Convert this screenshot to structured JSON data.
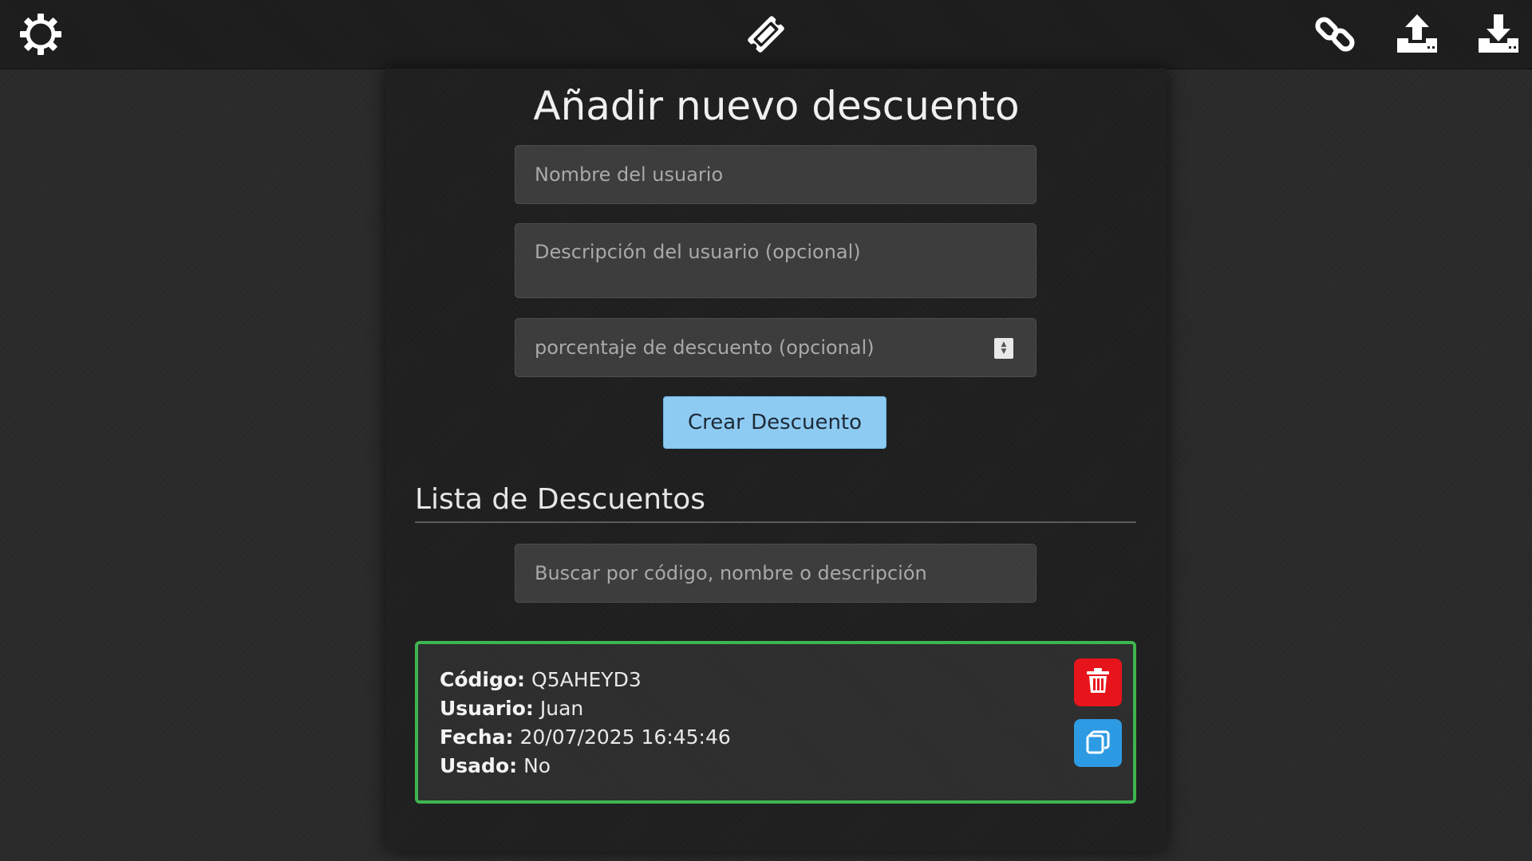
{
  "topbar": {
    "settings_icon": "gear-icon",
    "logo_icon": "ticket-icon",
    "link_icon": "link-icon",
    "upload_icon": "upload-icon",
    "download_icon": "download-icon"
  },
  "form": {
    "title": "Añadir nuevo descuento",
    "name_placeholder": "Nombre del usuario",
    "description_placeholder": "Descripción del usuario (opcional)",
    "percent_placeholder": "porcentaje de descuento (opcional)",
    "submit_label": "Crear Descuento"
  },
  "list": {
    "title": "Lista de Descuentos",
    "search_placeholder": "Buscar por código, nombre o descripción",
    "items": [
      {
        "code_label": "Código:",
        "code": "Q5AHEYD3",
        "user_label": "Usuario:",
        "user": "Juan",
        "date_label": "Fecha:",
        "date": "20/07/2025 16:45:46",
        "used_label": "Usado:",
        "used": "No",
        "status_color": "#3eb550",
        "delete_icon": "trash-icon",
        "copy_icon": "copy-icon"
      }
    ]
  },
  "colors": {
    "primary_button": "#8ecbf3",
    "delete_button": "#e8141c",
    "copy_button": "#2d9be3",
    "card_border": "#3eb550"
  }
}
